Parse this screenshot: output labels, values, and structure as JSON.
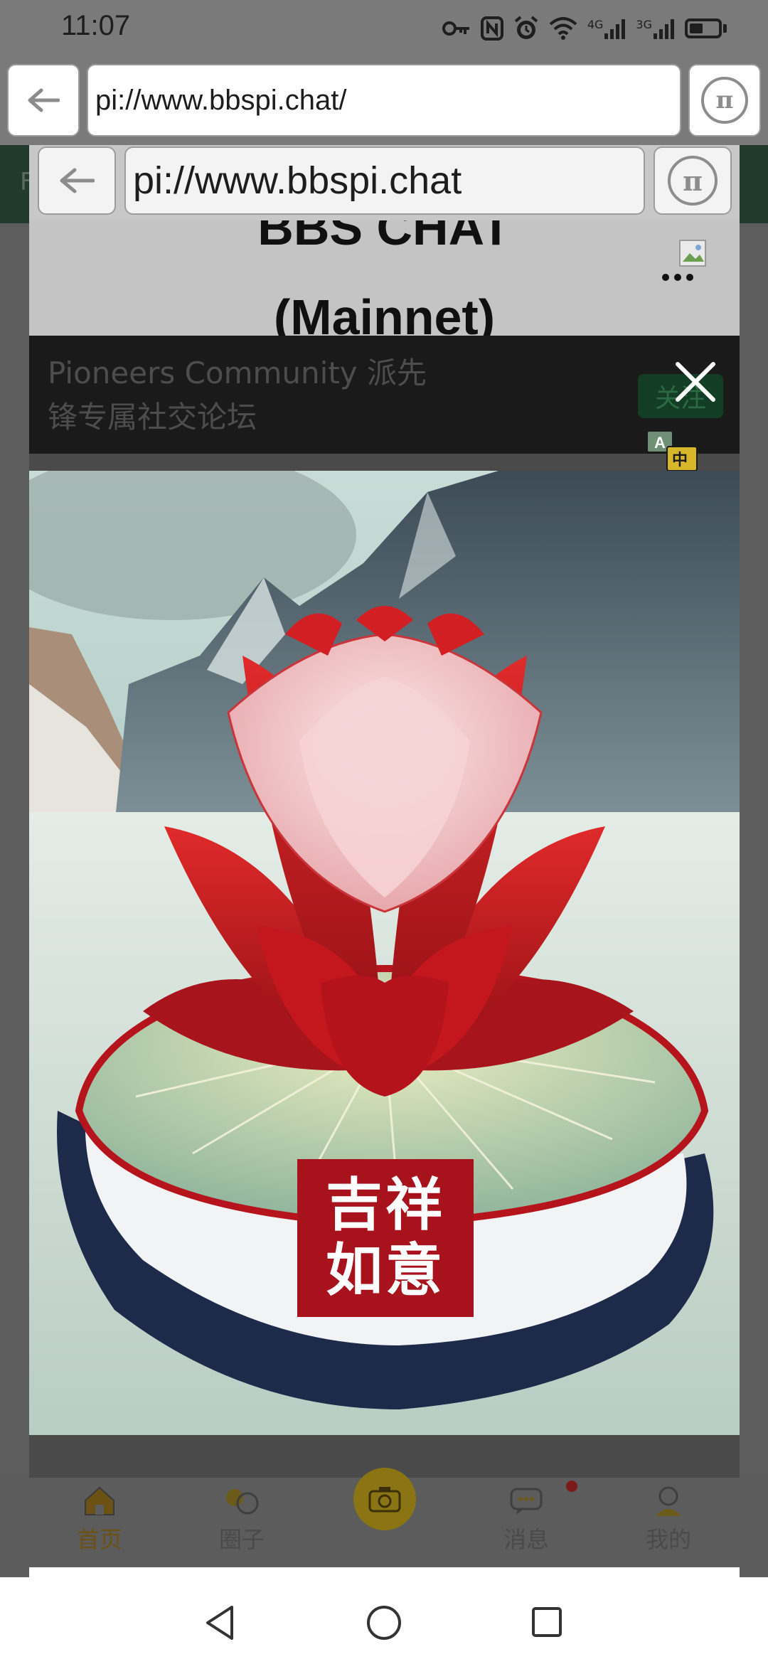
{
  "status_bar": {
    "time": "11:07",
    "signal_labels": [
      "4G",
      "3G"
    ],
    "icons": [
      "key-icon",
      "nfc-icon",
      "alarm-icon",
      "wifi-icon",
      "signal-icon",
      "signal-icon",
      "battery-icon"
    ]
  },
  "outer_browser": {
    "url": "pi://www.bbspi.chat/",
    "back_icon": "arrow-left-icon",
    "pi_icon": "pi-icon"
  },
  "inner_browser": {
    "url": "pi://www.bbspi.chat",
    "back_icon": "arrow-left-icon",
    "pi_icon": "pi-icon"
  },
  "background_page": {
    "left_letter": "F"
  },
  "app_header": {
    "title_line1": "BBS CHAT",
    "title_line2": "(Mainnet)"
  },
  "community": {
    "description": "Pioneers Community 派先锋专属社交论坛",
    "follow_label": "关注"
  },
  "image_viewer": {
    "seal_line1": "吉祥",
    "seal_line2": "如意"
  },
  "tab_bar": {
    "tabs": [
      {
        "label": "首页",
        "icon": "home-icon",
        "active": true
      },
      {
        "label": "圈子",
        "icon": "circles-icon",
        "active": false
      },
      {
        "label": "",
        "icon": "camera-icon",
        "active": false
      },
      {
        "label": "消息",
        "icon": "message-icon",
        "active": false
      },
      {
        "label": "我的",
        "icon": "profile-icon",
        "active": false
      }
    ]
  },
  "colors": {
    "accent": "#ffd43b",
    "seal_red": "#a7121d",
    "follow_green": "#1db954"
  },
  "nav_bar": {
    "icons": [
      "back-triangle-icon",
      "home-circle-icon",
      "recents-square-icon"
    ]
  }
}
